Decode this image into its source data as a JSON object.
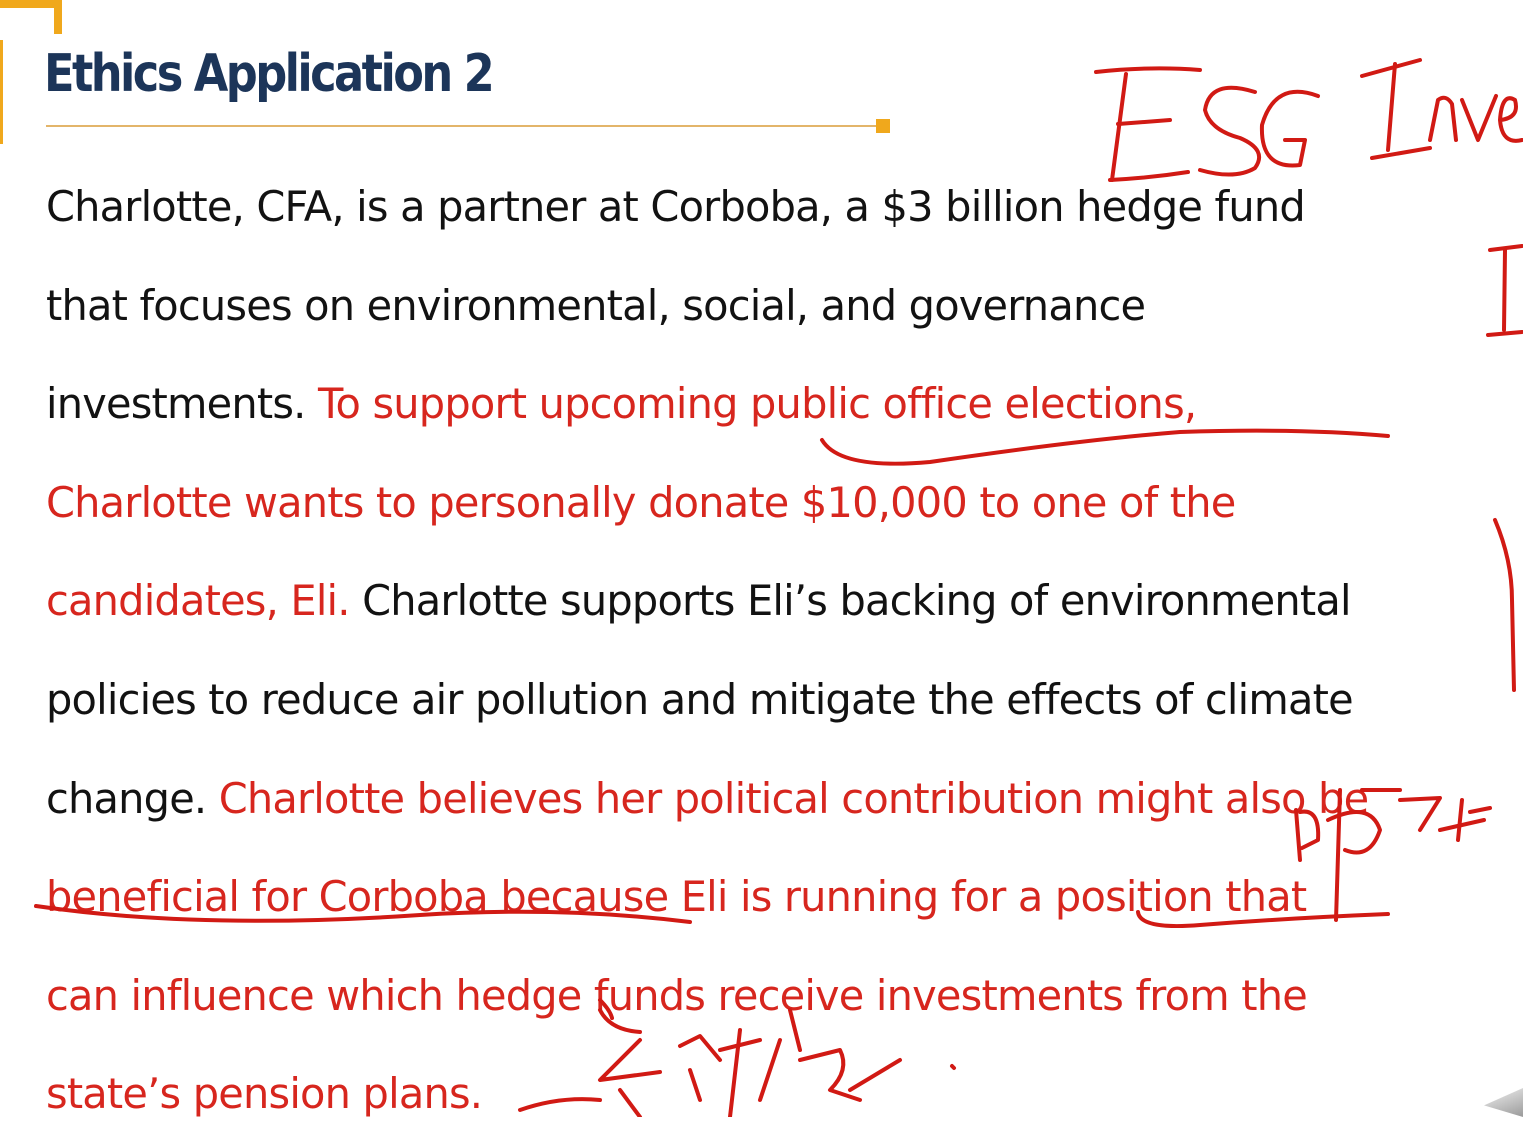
{
  "slide": {
    "title": "Ethics Application 2",
    "lines": [
      [
        {
          "text": "Charlotte, CFA, is a partner at Corboba, a $3 billion hedge fund",
          "style": "normal"
        }
      ],
      [
        {
          "text": "that focuses on environmental, social, and governance",
          "style": "normal"
        }
      ],
      [
        {
          "text": "investments. ",
          "style": "normal"
        },
        {
          "text": "To support upcoming public office elections,",
          "style": "red"
        }
      ],
      [
        {
          "text": "Charlotte wants to personally donate $10,000 to one of the",
          "style": "red"
        }
      ],
      [
        {
          "text": "candidates, Eli. ",
          "style": "red"
        },
        {
          "text": "Charlotte supports Eli’s backing of environmental",
          "style": "normal"
        }
      ],
      [
        {
          "text": "policies to reduce air pollution and mitigate the effects of climate",
          "style": "normal"
        }
      ],
      [
        {
          "text": "change. ",
          "style": "normal"
        },
        {
          "text": "Charlotte believes her political contribution might also be",
          "style": "red"
        }
      ],
      [
        {
          "text": "beneficial for Corboba because Eli is running for a position that",
          "style": "red"
        }
      ],
      [
        {
          "text": "can influence which hedge funds receive investments from the",
          "style": "red"
        }
      ],
      [
        {
          "text": "state’s pension plans.",
          "style": "red"
        }
      ]
    ]
  },
  "annotations": {
    "handwriting_esg": "ESG Inve",
    "ink_color": "#d11a14"
  },
  "colors": {
    "title": "#1c3559",
    "accent": "#f0a81c",
    "body_text": "#121212",
    "highlight_text": "#d7261e"
  }
}
